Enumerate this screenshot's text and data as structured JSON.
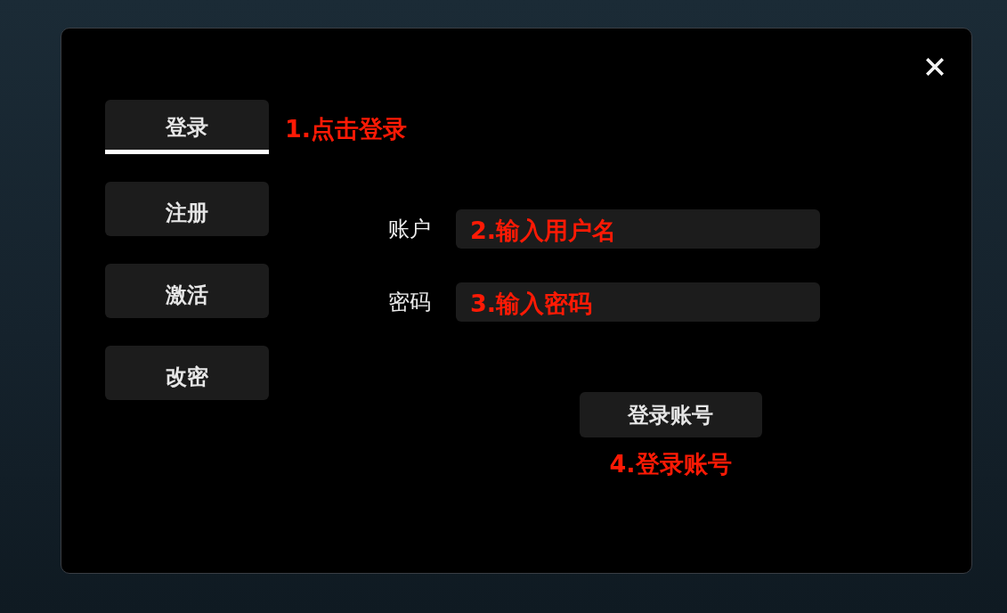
{
  "dialog": {
    "tabs": [
      {
        "label": "登录",
        "selected": true,
        "annotation": "1.点击登录"
      },
      {
        "label": "注册",
        "selected": false
      },
      {
        "label": "激活",
        "selected": false
      },
      {
        "label": "改密",
        "selected": false
      }
    ],
    "fields": [
      {
        "label": "账户",
        "annotation": "2.输入用户名"
      },
      {
        "label": "密码",
        "annotation": "3.输入密码"
      }
    ],
    "submit_button": {
      "label": "登录账号",
      "annotation": "4.登录账号"
    }
  }
}
